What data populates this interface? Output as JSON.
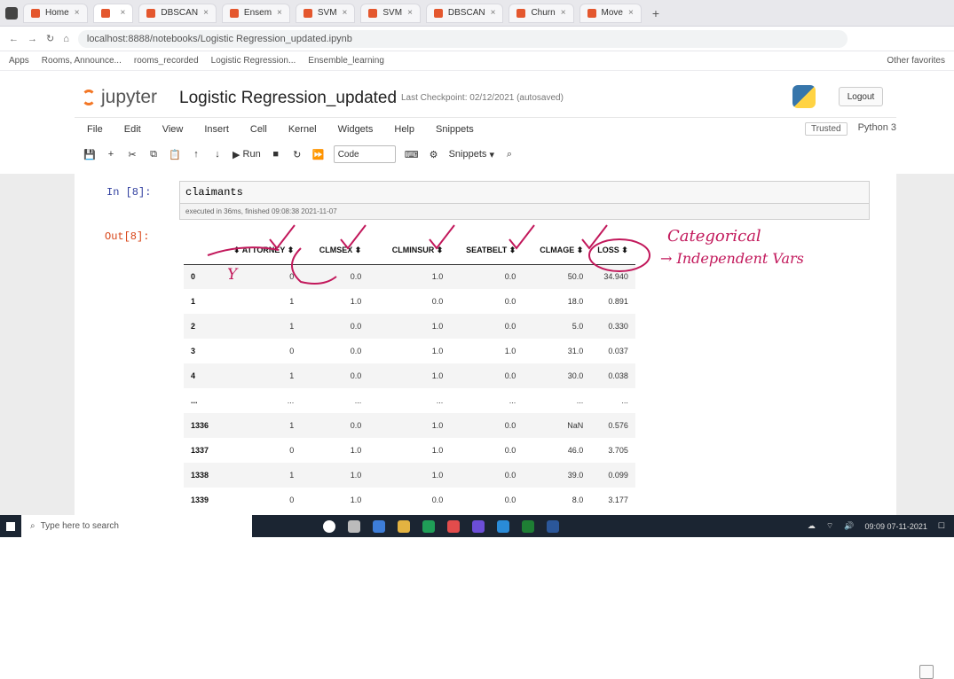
{
  "browser": {
    "tabs": [
      "Home",
      "",
      "DBSCAN",
      "Ensem",
      "SVM",
      "SVM",
      "DBSCAN",
      "Churn",
      "Move"
    ],
    "url": "localhost:8888/notebooks/Logistic Regression_updated.ipynb",
    "bookmarks": [
      "Apps",
      "Rooms, Announce...",
      "rooms_recorded",
      "Logistic Regression...",
      "Ensemble_learning"
    ],
    "other_favorites": "Other favorites"
  },
  "jupyter": {
    "logo_text": "jupyter",
    "notebook_title": "Logistic Regression_updated",
    "checkpoint": "Last Checkpoint: 02/12/2021  (autosaved)",
    "logout": "Logout",
    "menu": [
      "File",
      "Edit",
      "View",
      "Insert",
      "Cell",
      "Kernel",
      "Widgets",
      "Help",
      "Snippets"
    ],
    "trusted": "Trusted",
    "kernel": "Python 3",
    "toolbar": {
      "run": "Run",
      "celltype": "Code",
      "snippets": "Snippets"
    }
  },
  "cell": {
    "in_prompt": "In [8]:",
    "code": "claimants",
    "exec_info": "executed in 36ms, finished 09:08:38 2021-11-07",
    "out_prompt": "Out[8]:"
  },
  "table": {
    "headers": [
      "",
      "ATTORNEY",
      "CLMSEX",
      "CLMINSUR",
      "SEATBELT",
      "CLMAGE",
      "LOSS"
    ],
    "rows": [
      [
        "0",
        "0",
        "0.0",
        "1.0",
        "0.0",
        "50.0",
        "34.940"
      ],
      [
        "1",
        "1",
        "1.0",
        "0.0",
        "0.0",
        "18.0",
        "0.891"
      ],
      [
        "2",
        "1",
        "0.0",
        "1.0",
        "0.0",
        "5.0",
        "0.330"
      ],
      [
        "3",
        "0",
        "0.0",
        "1.0",
        "1.0",
        "31.0",
        "0.037"
      ],
      [
        "4",
        "1",
        "0.0",
        "1.0",
        "0.0",
        "30.0",
        "0.038"
      ],
      [
        "...",
        "...",
        "...",
        "...",
        "...",
        "...",
        "..."
      ],
      [
        "1336",
        "1",
        "0.0",
        "1.0",
        "0.0",
        "NaN",
        "0.576"
      ],
      [
        "1337",
        "0",
        "1.0",
        "1.0",
        "0.0",
        "46.0",
        "3.705"
      ],
      [
        "1338",
        "1",
        "1.0",
        "1.0",
        "0.0",
        "39.0",
        "0.099"
      ],
      [
        "1339",
        "0",
        "1.0",
        "0.0",
        "0.0",
        "8.0",
        "3.177"
      ]
    ]
  },
  "annotations": {
    "line1": "Categorical",
    "line2": "Independent Vars",
    "mark": "Y"
  },
  "taskbar": {
    "search": "Type here to search",
    "time": "09:09",
    "date": "07-11-2021"
  }
}
